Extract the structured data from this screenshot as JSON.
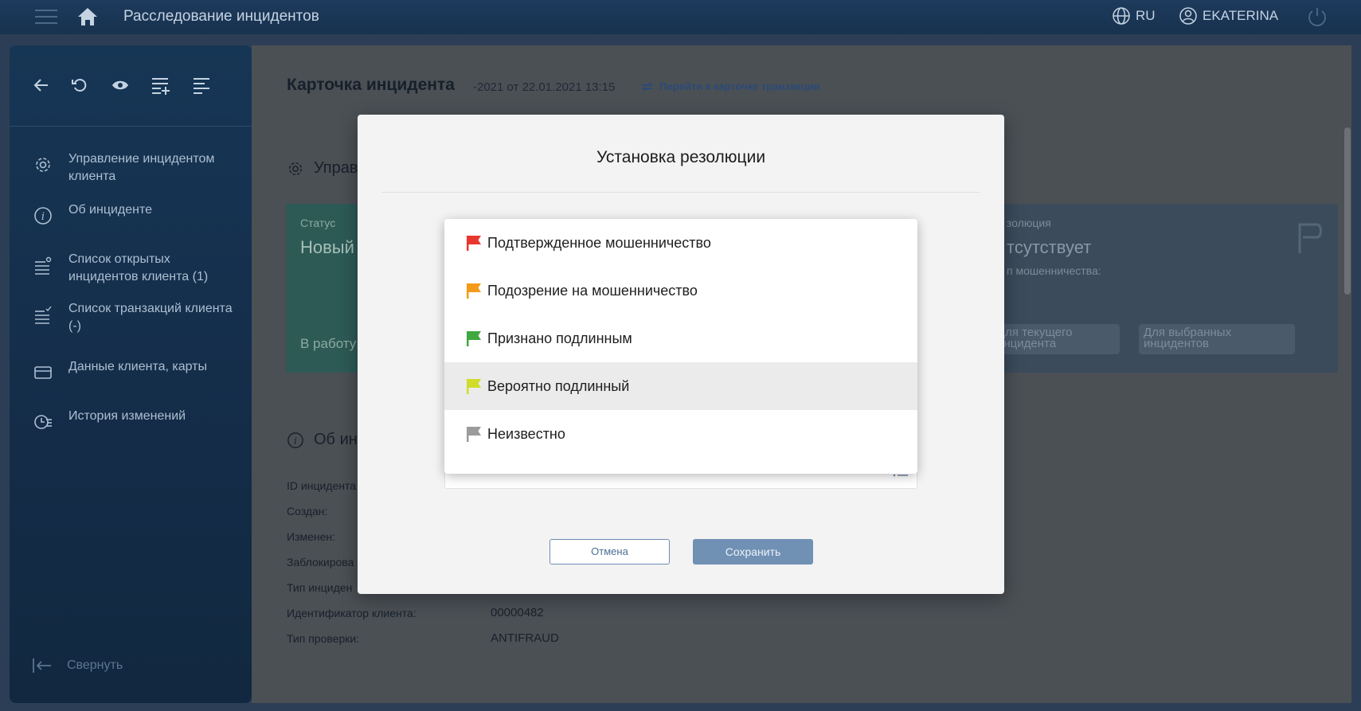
{
  "header": {
    "app_title": "Расследование инцидентов",
    "lang": "RU",
    "user": "EKATERINA"
  },
  "sidebar": {
    "items": [
      {
        "label": "Управление инцидентом клиента",
        "icon": "gear-icon"
      },
      {
        "label": "Об инциденте",
        "icon": "info-icon"
      },
      {
        "label": "Список открытых инцидентов клиента (1)",
        "icon": "list-settings-icon"
      },
      {
        "label": "Список транзакций клиента (-)",
        "icon": "list-check-icon"
      },
      {
        "label": "Данные клиента, карты",
        "icon": "card-icon"
      },
      {
        "label": "История изменений",
        "icon": "history-icon"
      }
    ],
    "collapse_label": "Свернуть"
  },
  "main": {
    "card_title": "Карточка инцидента",
    "card_subtitle": "-2021 от 22.01.2021 13:15",
    "transaction_link": "Перейти к карточке транзакции",
    "section_manage": "Управ",
    "status_label": "Статус",
    "status_value": "Новый",
    "status_button": "В работу",
    "resolution_label": "золюция",
    "resolution_value": "тсутствует",
    "resolution_sub": "п мошенничества:",
    "res_btn_current": "Для текущего инцидента",
    "res_btn_selected": "Для выбранных инцидентов",
    "section_about": "Об ин",
    "info_rows": [
      {
        "label": "ID инцидента",
        "value": ""
      },
      {
        "label": "Создан:",
        "value": ""
      },
      {
        "label": "Изменен:",
        "value": ""
      },
      {
        "label": "Заблокирова",
        "value": ""
      },
      {
        "label": "Тип инциден",
        "value": ""
      },
      {
        "label": "Идентификатор клиента:",
        "value": "00000482"
      },
      {
        "label": "Тип проверки:",
        "value": "ANTIFRAUD"
      }
    ]
  },
  "modal": {
    "title": "Установка резолюции",
    "cancel": "Отмена",
    "save": "Сохранить",
    "options": [
      {
        "label": "Подтвержденное мошенничество",
        "color": "#e8382e"
      },
      {
        "label": "Подозрение на мошенничество",
        "color": "#f39a1a"
      },
      {
        "label": "Признано подлинным",
        "color": "#3fa83f"
      },
      {
        "label": "Вероятно подлинный",
        "color": "#cfdc2a",
        "highlighted": true
      },
      {
        "label": "Неизвестно",
        "color": "#9b9b9b"
      }
    ]
  }
}
